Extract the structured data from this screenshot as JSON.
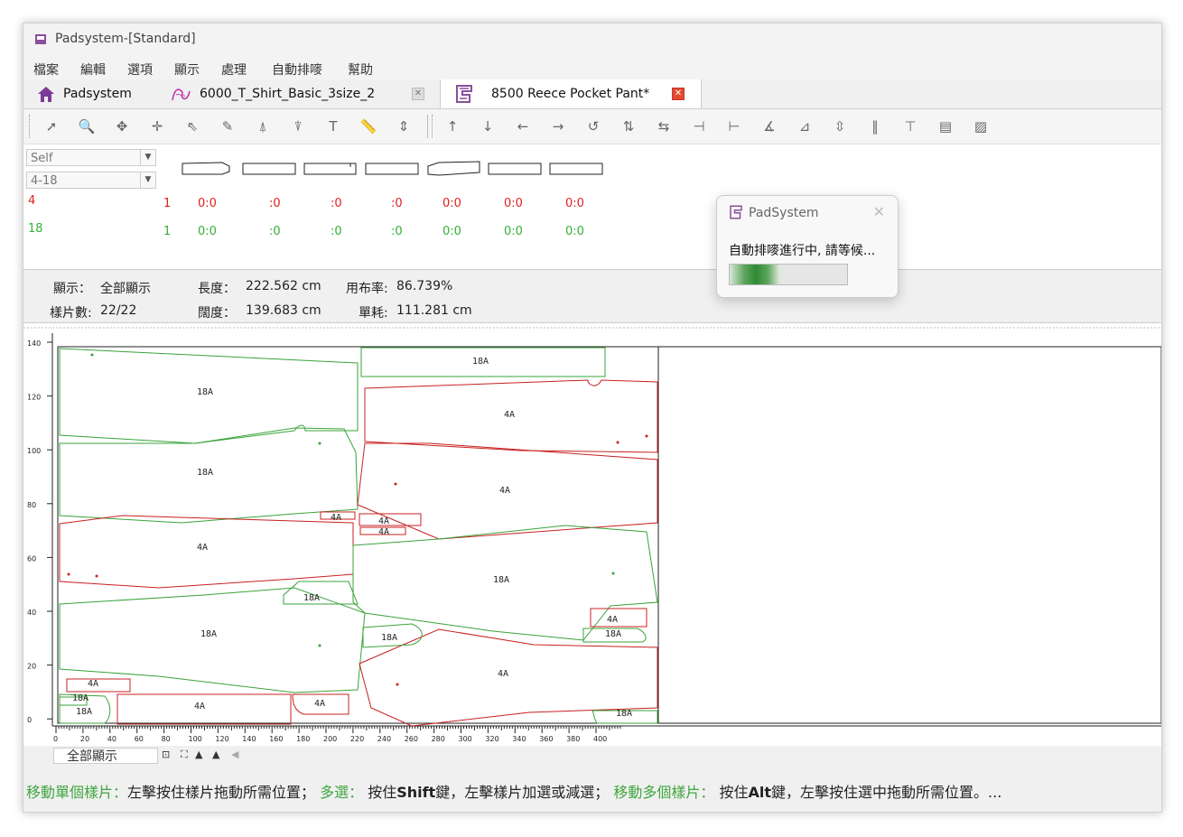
{
  "window": {
    "title": "Padsystem-[Standard]"
  },
  "menu": [
    "檔案",
    "編輯",
    "選項",
    "顯示",
    "處理",
    "自動排嘜",
    "幫助"
  ],
  "tabs": [
    {
      "label": "Padsystem",
      "icon": "home-icon"
    },
    {
      "label": "6000_T_Shirt_Basic_3size_2",
      "icon": "shirt-icon"
    },
    {
      "label": "8500 Reece Pocket Pant*",
      "icon": "padsystem-icon",
      "active": true
    }
  ],
  "toolbar": {
    "left_tools": [
      "select-arrow-icon",
      "zoom-icon",
      "move-icon",
      "pan-icon",
      "pointer-icon",
      "edit-icon",
      "align-top-icon",
      "align-bottom-icon",
      "text-icon",
      "ruler-icon",
      "spacing-icon"
    ],
    "right_tools": [
      "move-up-icon",
      "move-down-icon",
      "move-left-icon",
      "move-right-icon",
      "rotate-icon",
      "flip-vertical-icon",
      "flip-horizontal-icon",
      "align-left-icon",
      "align-right-icon",
      "rotate-angle-icon",
      "tilt-icon",
      "distribute-icon",
      "bars-icon",
      "top-line-icon",
      "layer-icon",
      "shade-icon"
    ]
  },
  "piece_panel": {
    "mode_select": "Self",
    "size_range_select": "4-18",
    "sizes": [
      {
        "label": "4",
        "color": "#e02020",
        "counts": [
          "1",
          "0:0",
          ":0",
          ":0",
          ":0",
          "0:0",
          "0:0",
          "0:0"
        ]
      },
      {
        "label": "18",
        "color": "#35b035",
        "counts": [
          "1",
          "0:0",
          ":0",
          ":0",
          ":0",
          "0:0",
          "0:0",
          "0:0"
        ]
      }
    ]
  },
  "info": {
    "display_label": "顯示：",
    "display_value": "全部顯示",
    "length_label": "長度：",
    "length_value": "222.562 cm",
    "usage_label": "用布率:",
    "usage_value": "86.739%",
    "pieces_label": "樣片數:",
    "pieces_value": "22/22",
    "width_label": "闊度：",
    "width_value": "139.683 cm",
    "unit_label": "單耗:",
    "unit_value": "111.281 cm"
  },
  "marker": {
    "y_ticks": [
      "140",
      "120",
      "100",
      "80",
      "60",
      "40",
      "20",
      "0"
    ],
    "x_ticks": [
      "0",
      "20",
      "40",
      "60",
      "80",
      "100",
      "120",
      "140",
      "160",
      "180",
      "200",
      "220",
      "240",
      "260",
      "280",
      "300",
      "320",
      "340",
      "360",
      "380",
      "400"
    ],
    "piece_labels": [
      "18A",
      "18A",
      "4A",
      "18A",
      "4A",
      "4A",
      "4A",
      "4A",
      "4A",
      "18A",
      "18A",
      "18A",
      "4A",
      "18A",
      "18A",
      "4A",
      "4A",
      "18A",
      "18A",
      "4A",
      "4A",
      "18A"
    ]
  },
  "bottom": {
    "display_select": "全部顯示",
    "status": {
      "t1": "移動單個樣片：",
      "t2": "左擊按住樣片拖動所需位置；",
      "t3": "多選：",
      "t4": "按住",
      "t5": "Shift",
      "t6": "鍵，左擊樣片加選或減選；",
      "t7": "移動多個樣片：",
      "t8": "按住",
      "t9": "Alt",
      "t10": "鍵，左擊按住選中拖動所需位置。..."
    }
  },
  "dialog": {
    "title": "PadSystem",
    "message": "自動排嘜進行中, 請等候...",
    "progress": 0.5
  },
  "colors": {
    "size_small": "#cc1f1f",
    "size_large": "#3aa33a",
    "status_highlight": "#3fa63f"
  }
}
